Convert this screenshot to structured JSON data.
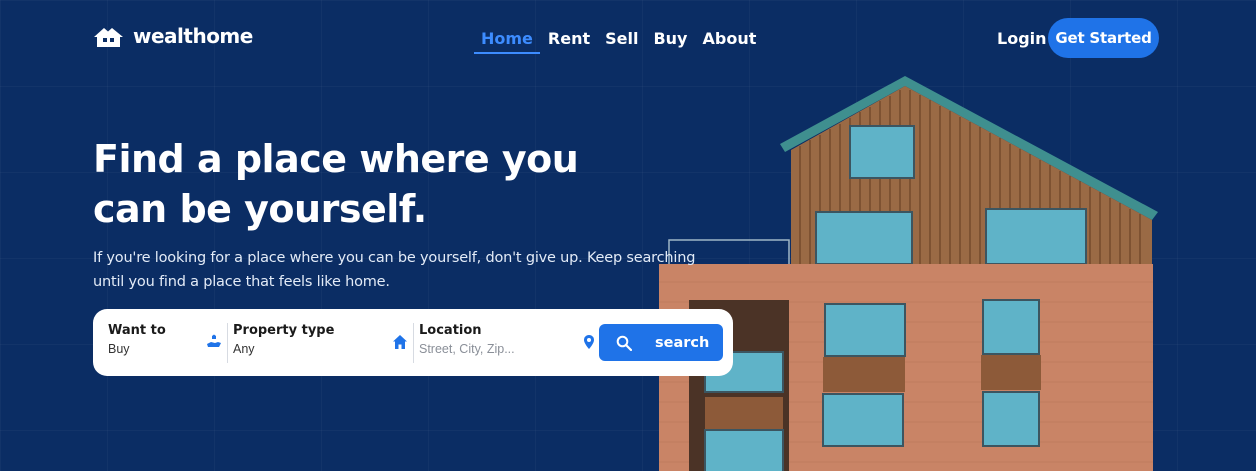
{
  "brand": {
    "name": "wealthome",
    "icon": "house-logo-icon"
  },
  "nav": {
    "items": [
      {
        "label": "Home",
        "active": true
      },
      {
        "label": "Rent",
        "active": false
      },
      {
        "label": "Sell",
        "active": false
      },
      {
        "label": "Buy",
        "active": false
      },
      {
        "label": "About",
        "active": false
      }
    ],
    "login_label": "Login",
    "cta_label": "Get Started"
  },
  "hero": {
    "title_line1": "Find a place where you",
    "title_line2": "can be yourself.",
    "subtitle_line1": "If you're looking for a place where you can be yourself, don't give up. Keep searching",
    "subtitle_line2": "until you find a place that feels like home."
  },
  "search": {
    "want_to": {
      "label": "Want to",
      "value": "Buy",
      "icon": "hand-house-icon"
    },
    "property_type": {
      "label": "Property type",
      "value": "Any",
      "icon": "home-icon"
    },
    "location": {
      "label": "Location",
      "placeholder": "Street, City, Zip...",
      "icon": "map-pin-icon"
    },
    "button_label": "search",
    "button_icon": "search-icon"
  },
  "colors": {
    "background": "#0b2d64",
    "accent": "#1f73e8",
    "nav_active": "#3d8cff"
  }
}
